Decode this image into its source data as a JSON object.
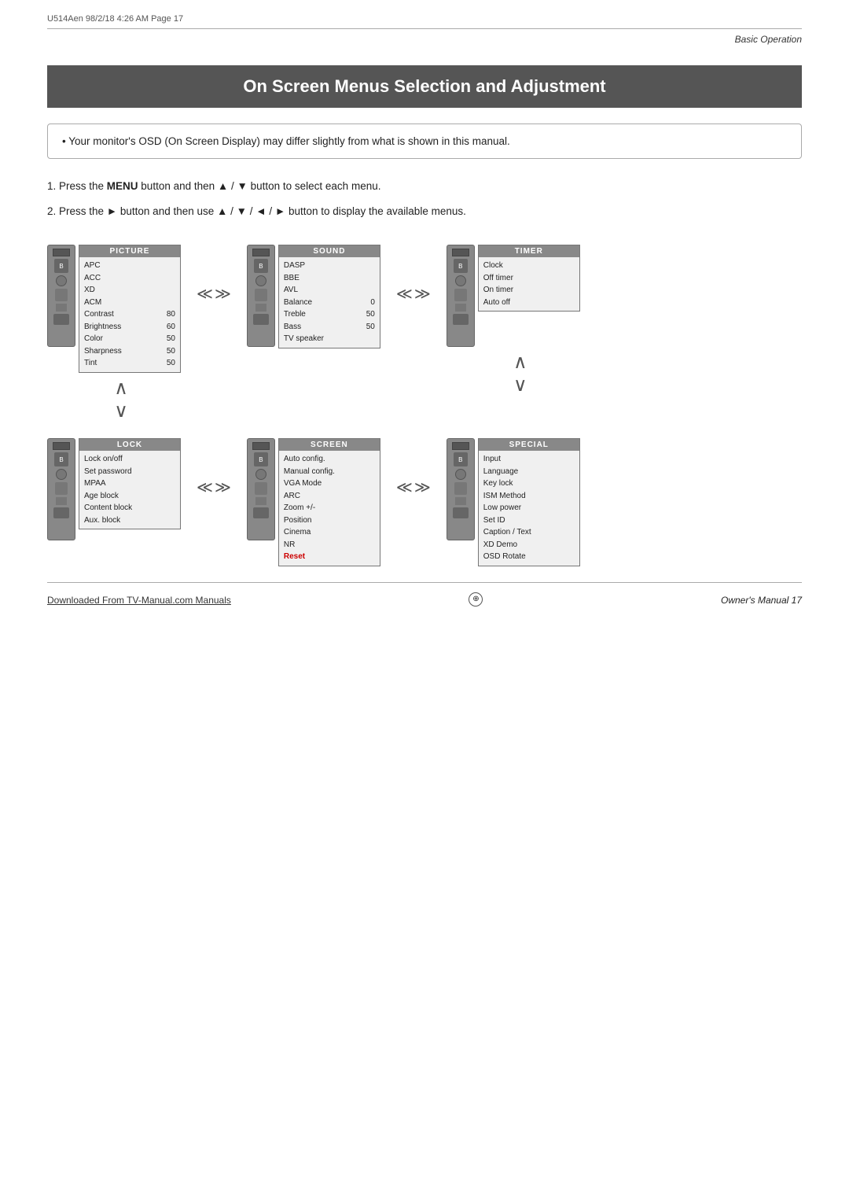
{
  "meta": {
    "file_info": "U514Aen  98/2/18  4:26 AM   Page 17"
  },
  "section_label": "Basic Operation",
  "title": "On Screen Menus Selection and Adjustment",
  "info_box": "• Your monitor's OSD (On Screen Display) may differ slightly from what is shown in this manual.",
  "instructions": [
    {
      "id": "step1",
      "number": "1.",
      "text_before": "Press the ",
      "bold": "MENU",
      "text_after": " button and then ▲ / ▼  button to select each menu."
    },
    {
      "id": "step2",
      "number": "2.",
      "text_before": "Press the ► button and then use ▲ / ▼ / ◄ / ► button to display the available menus."
    }
  ],
  "menus": {
    "row1": [
      {
        "id": "picture",
        "header": "PICTURE",
        "items": [
          {
            "label": "APC",
            "value": ""
          },
          {
            "label": "ACC",
            "value": ""
          },
          {
            "label": "XD",
            "value": ""
          },
          {
            "label": "ACM",
            "value": ""
          },
          {
            "label": "Contrast",
            "value": "80"
          },
          {
            "label": "Brightness",
            "value": "60"
          },
          {
            "label": "Color",
            "value": "50"
          },
          {
            "label": "Sharpness",
            "value": "50"
          },
          {
            "label": "Tint",
            "value": "50"
          }
        ]
      },
      {
        "id": "sound",
        "header": "SOUND",
        "items": [
          {
            "label": "DASP",
            "value": ""
          },
          {
            "label": "BBE",
            "value": ""
          },
          {
            "label": "AVL",
            "value": ""
          },
          {
            "label": "Balance",
            "value": "0"
          },
          {
            "label": "Treble",
            "value": "50"
          },
          {
            "label": "Bass",
            "value": "50"
          },
          {
            "label": "TV speaker",
            "value": ""
          }
        ]
      },
      {
        "id": "timer",
        "header": "TIMER",
        "items": [
          {
            "label": "Clock",
            "value": ""
          },
          {
            "label": "Off timer",
            "value": ""
          },
          {
            "label": "On timer",
            "value": ""
          },
          {
            "label": "Auto off",
            "value": ""
          }
        ]
      }
    ],
    "row2": [
      {
        "id": "lock",
        "header": "LOCK",
        "items": [
          {
            "label": "Lock on/off",
            "value": ""
          },
          {
            "label": "Set password",
            "value": ""
          },
          {
            "label": "MPAA",
            "value": ""
          },
          {
            "label": "Age block",
            "value": ""
          },
          {
            "label": "Content block",
            "value": ""
          },
          {
            "label": "Aux. block",
            "value": ""
          }
        ]
      },
      {
        "id": "screen",
        "header": "SCREEN",
        "items": [
          {
            "label": "Auto config.",
            "value": ""
          },
          {
            "label": "Manual config.",
            "value": ""
          },
          {
            "label": "VGA Mode",
            "value": ""
          },
          {
            "label": "ARC",
            "value": ""
          },
          {
            "label": "Zoom +/-",
            "value": ""
          },
          {
            "label": "Position",
            "value": ""
          },
          {
            "label": "Cinema",
            "value": ""
          },
          {
            "label": "NR",
            "value": ""
          },
          {
            "label": "Reset",
            "value": ""
          }
        ]
      },
      {
        "id": "special",
        "header": "SPECIAL",
        "items": [
          {
            "label": "Input",
            "value": ""
          },
          {
            "label": "Language",
            "value": ""
          },
          {
            "label": "Key lock",
            "value": ""
          },
          {
            "label": "ISM Method",
            "value": ""
          },
          {
            "label": "Low power",
            "value": ""
          },
          {
            "label": "Set ID",
            "value": ""
          },
          {
            "label": "Caption / Text",
            "value": ""
          },
          {
            "label": "XD Demo",
            "value": ""
          },
          {
            "label": "OSD Rotate",
            "value": ""
          }
        ]
      }
    ]
  },
  "footer": {
    "link_text": "Downloaded From TV-Manual.com Manuals",
    "page_label": "Owner's Manual  17"
  }
}
